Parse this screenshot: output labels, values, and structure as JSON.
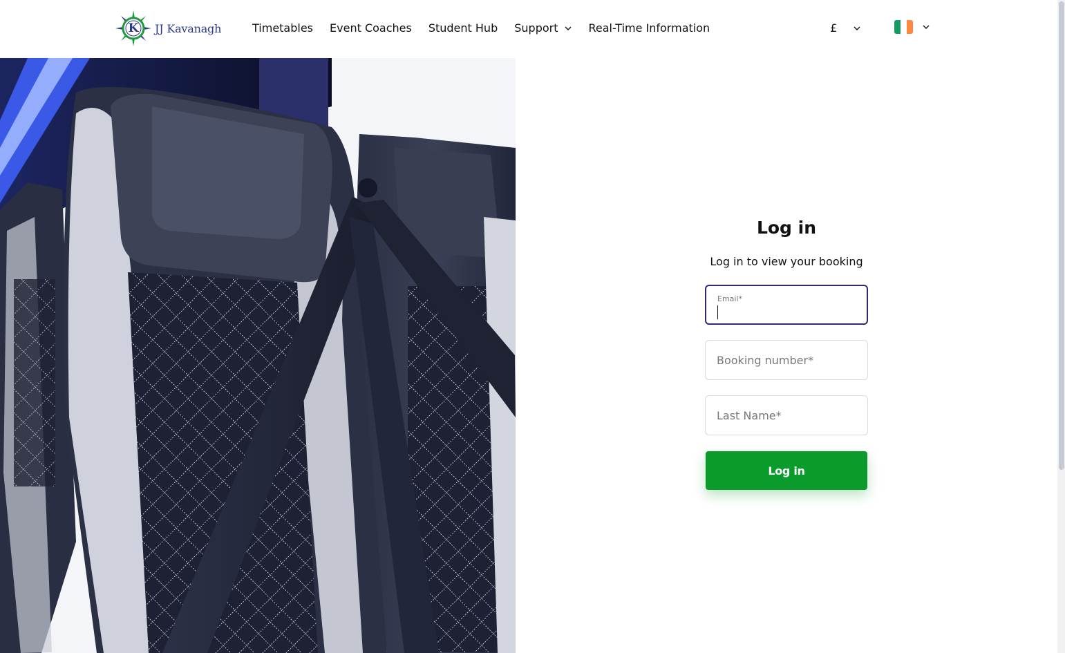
{
  "brand": {
    "name": "JJ Kavanagh",
    "monogram": "K",
    "colors": {
      "navy": "#2b3a8a",
      "green": "#1e9a3c"
    }
  },
  "nav": {
    "items": [
      {
        "label": "Timetables"
      },
      {
        "label": "Event Coaches"
      },
      {
        "label": "Student Hub"
      },
      {
        "label": "Support",
        "has_dropdown": true
      },
      {
        "label": "Real-Time Information"
      }
    ]
  },
  "currency": {
    "symbol": "£",
    "icon": "chevron-down-icon"
  },
  "language": {
    "flag": "ireland-flag-icon",
    "flag_colors": [
      "#169b62",
      "#ffffff",
      "#ff883e"
    ],
    "icon": "chevron-down-icon"
  },
  "hero": {
    "subject": "coach-seat-photo"
  },
  "login": {
    "title": "Log in",
    "subtitle": "Log in to view your booking",
    "email": {
      "label": "Email*",
      "value": ""
    },
    "booking_number": {
      "placeholder": "Booking number*",
      "value": ""
    },
    "last_name": {
      "placeholder": "Last Name*",
      "value": ""
    },
    "submit_label": "Log in",
    "colors": {
      "button": "#0a9b2c",
      "focus_border": "#2e2a6b"
    }
  }
}
